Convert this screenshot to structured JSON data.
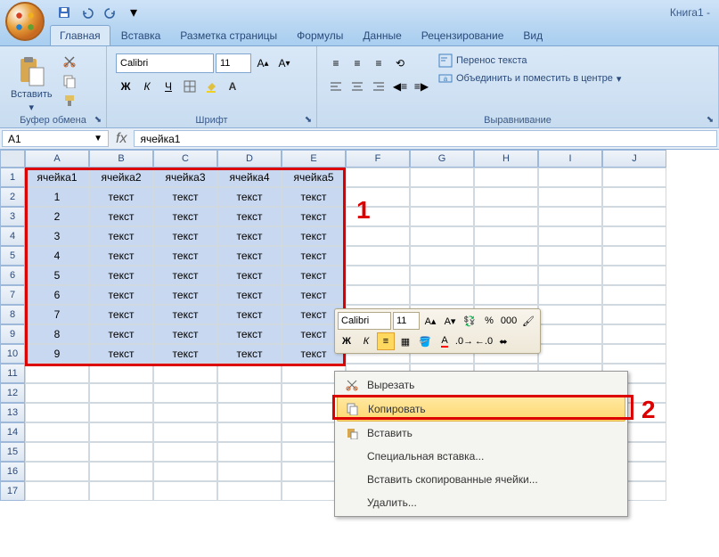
{
  "title": "Книга1 -",
  "tabs": [
    "Главная",
    "Вставка",
    "Разметка страницы",
    "Формулы",
    "Данные",
    "Рецензирование",
    "Вид"
  ],
  "activeTab": 0,
  "clipboard": {
    "paste": "Вставить",
    "label": "Буфер обмена"
  },
  "font": {
    "name": "Calibri",
    "size": "11",
    "bold": "Ж",
    "italic": "К",
    "underline": "Ч",
    "label": "Шрифт"
  },
  "alignment": {
    "wrap": "Перенос текста",
    "merge": "Объединить и поместить в центре",
    "label": "Выравнивание"
  },
  "namebox": "A1",
  "formula": "ячейка1",
  "cols": [
    "A",
    "B",
    "C",
    "D",
    "E",
    "F",
    "G",
    "H",
    "I",
    "J"
  ],
  "rows": [
    "1",
    "2",
    "3",
    "4",
    "5",
    "6",
    "7",
    "8",
    "9",
    "10",
    "11",
    "12",
    "13",
    "14",
    "15",
    "16",
    "17"
  ],
  "chart_data": {
    "type": "table",
    "headers": [
      "ячейка1",
      "ячейка2",
      "ячейка3",
      "ячейка4",
      "ячейка5"
    ],
    "rows": [
      [
        "1",
        "текст",
        "текст",
        "текст",
        "текст"
      ],
      [
        "2",
        "текст",
        "текст",
        "текст",
        "текст"
      ],
      [
        "3",
        "текст",
        "текст",
        "текст",
        "текст"
      ],
      [
        "4",
        "текст",
        "текст",
        "текст",
        "текст"
      ],
      [
        "5",
        "текст",
        "текст",
        "текст",
        "текст"
      ],
      [
        "6",
        "текст",
        "текст",
        "текст",
        "текст"
      ],
      [
        "7",
        "текст",
        "текст",
        "текст",
        "текст"
      ],
      [
        "8",
        "текст",
        "текст",
        "текст",
        "текст"
      ],
      [
        "9",
        "текст",
        "текст",
        "текст",
        "текст"
      ]
    ]
  },
  "minitb": {
    "font": "Calibri",
    "size": "11",
    "bold": "Ж",
    "italic": "К"
  },
  "ctx": {
    "cut": "Вырезать",
    "copy": "Копировать",
    "paste": "Вставить",
    "pastespecial": "Специальная вставка...",
    "insertcopied": "Вставить скопированные ячейки...",
    "delete": "Удалить..."
  },
  "annotations": {
    "one": "1",
    "two": "2"
  },
  "percent": "%",
  "zeros": "000"
}
